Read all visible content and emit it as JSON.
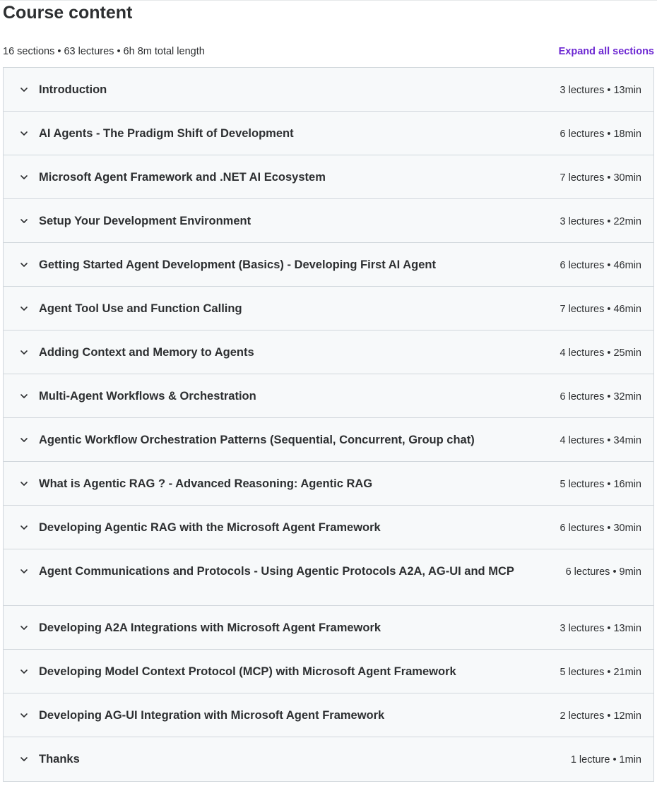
{
  "header": {
    "title": "Course content",
    "summary": "16 sections • 63 lectures • 6h 8m total length",
    "expand_label": "Expand all sections"
  },
  "colors": {
    "accent": "#6d28d2",
    "text": "#2d2f31",
    "section_bg": "#f7f9fa",
    "border": "#d1d7dc"
  },
  "icons": {
    "section_toggle": "chevron-down-icon"
  },
  "sections": [
    {
      "title": "Introduction",
      "meta": "3 lectures • 13min"
    },
    {
      "title": "AI Agents - The Pradigm Shift of Development",
      "meta": "6 lectures • 18min"
    },
    {
      "title": "Microsoft Agent Framework and .NET AI Ecosystem",
      "meta": "7 lectures • 30min"
    },
    {
      "title": "Setup Your Development Environment",
      "meta": "3 lectures • 22min"
    },
    {
      "title": "Getting Started Agent Development (Basics) - Developing First AI Agent",
      "meta": "6 lectures • 46min"
    },
    {
      "title": "Agent Tool Use and Function Calling",
      "meta": "7 lectures • 46min"
    },
    {
      "title": "Adding Context and Memory to Agents",
      "meta": "4 lectures • 25min"
    },
    {
      "title": "Multi-Agent Workflows & Orchestration",
      "meta": "6 lectures • 32min"
    },
    {
      "title": "Agentic Workflow Orchestration Patterns (Sequential, Concurrent, Group chat)",
      "meta": "4 lectures • 34min"
    },
    {
      "title": "What is Agentic RAG ? - Advanced Reasoning: Agentic RAG",
      "meta": "5 lectures • 16min"
    },
    {
      "title": "Developing Agentic RAG with the Microsoft Agent Framework",
      "meta": "6 lectures • 30min"
    },
    {
      "title": "Agent Communications and Protocols - Using Agentic Protocols A2A, AG-UI and MCP",
      "meta": "6 lectures • 9min"
    },
    {
      "title": "Developing A2A Integrations with Microsoft Agent Framework",
      "meta": "3 lectures • 13min"
    },
    {
      "title": "Developing Model Context Protocol (MCP) with Microsoft Agent Framework",
      "meta": "5 lectures • 21min"
    },
    {
      "title": "Developing AG-UI Integration with Microsoft Agent Framework",
      "meta": "2 lectures • 12min"
    },
    {
      "title": "Thanks",
      "meta": "1 lecture • 1min"
    }
  ]
}
